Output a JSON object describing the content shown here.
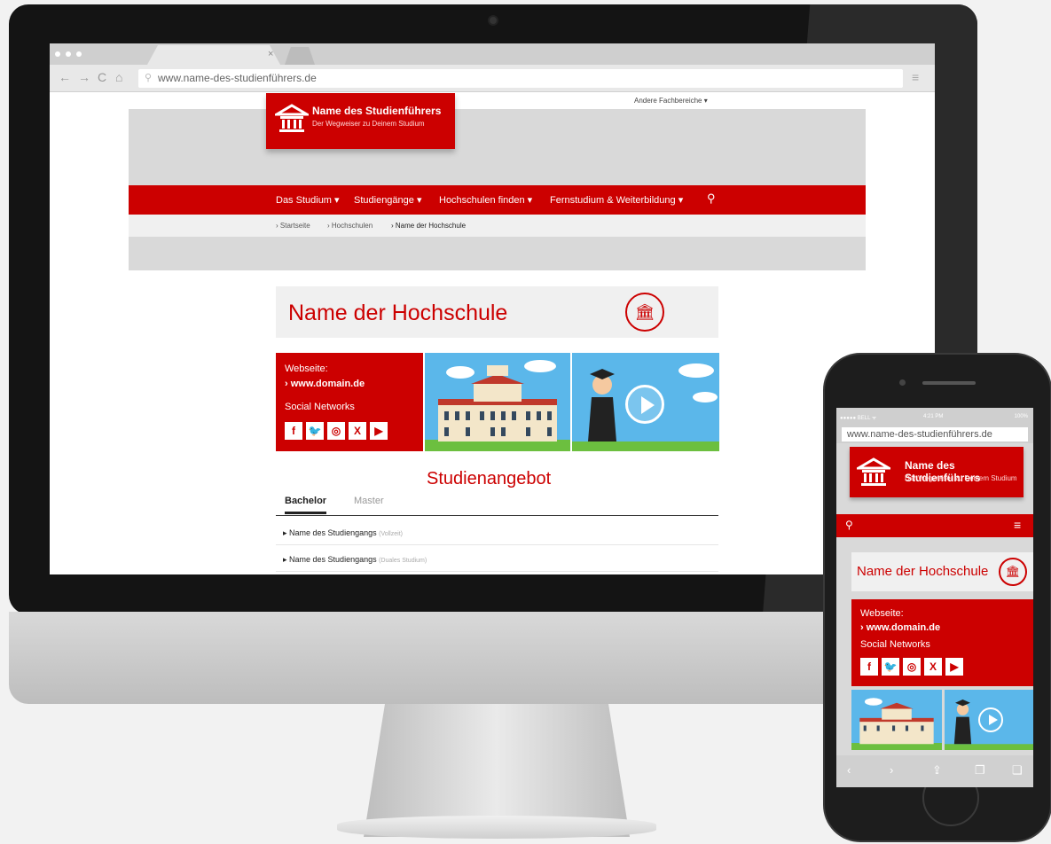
{
  "browser": {
    "url": "www.name-des-studienführers.de",
    "tab_close": "×"
  },
  "site": {
    "top_link": "Andere Fachbereiche",
    "logo_name": "Name des Studienführers",
    "logo_sub": "Der Wegweiser zu Deinem Studium",
    "nav": [
      "Das Studium",
      "Studiengänge",
      "Hochschulen finden",
      "Fernstudium & Weiterbildung"
    ],
    "breadcrumb": [
      "Startseite",
      "Hochschulen",
      "Name der Hochschule"
    ],
    "title": "Name der Hochschule",
    "website_label": "Webseite:",
    "website_link": "www.domain.de",
    "social_label": "Social Networks",
    "social_icons": [
      "f",
      "t",
      "ig",
      "x",
      "yt"
    ],
    "section_title": "Studienangebot",
    "tabs": [
      "Bachelor",
      "Master"
    ],
    "courses": [
      {
        "name": "Name des Studiengangs",
        "note": "(Vollzeit)"
      },
      {
        "name": "Name des Studiengangs",
        "note": "(Duales Studium)"
      }
    ]
  },
  "phone": {
    "status_left": "●●●●● BELL ᯤ",
    "status_time": "4:21 PM",
    "status_right": "100%",
    "url": "www.name-des-studienführers.de",
    "logo_name": "Name des Studienführers",
    "logo_sub": "Der Wegweiser zu Deinem Studium",
    "title": "Name der Hochschule",
    "website_label": "Webseite:",
    "website_link": "www.domain.de",
    "social_label": "Social Networks"
  },
  "colors": {
    "brand": "#cc0000",
    "sky": "#5bb7ea"
  }
}
